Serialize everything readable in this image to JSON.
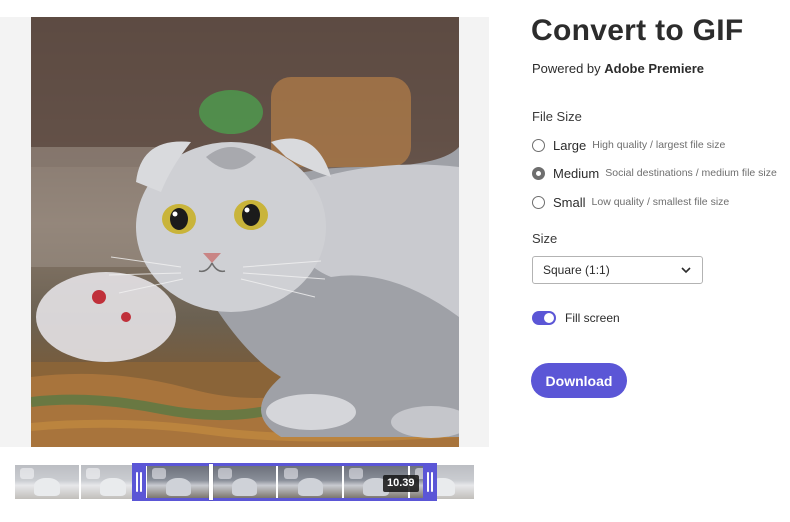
{
  "header": {
    "title": "Convert to GIF",
    "powered_prefix": "Powered by",
    "powered_brand": "Adobe Premiere"
  },
  "file_size": {
    "label": "File Size",
    "options": [
      {
        "label": "Large",
        "description": "High quality / largest file size",
        "selected": false
      },
      {
        "label": "Medium",
        "description": "Social destinations / medium file size",
        "selected": true
      },
      {
        "label": "Small",
        "description": "Low quality / smallest file size",
        "selected": false
      }
    ]
  },
  "size": {
    "label": "Size",
    "selected": "Square (1:1)"
  },
  "fill_screen": {
    "label": "Fill screen",
    "enabled": true
  },
  "download": {
    "label": "Download"
  },
  "timeline": {
    "duration": "10.39"
  },
  "colors": {
    "accent": "#5b56d6",
    "text": "#2c2c2c",
    "muted": "#6e6e6e"
  },
  "icons": {
    "select_chevron": "chevron-down-icon",
    "trim_handles": "drag-handle-icon"
  }
}
